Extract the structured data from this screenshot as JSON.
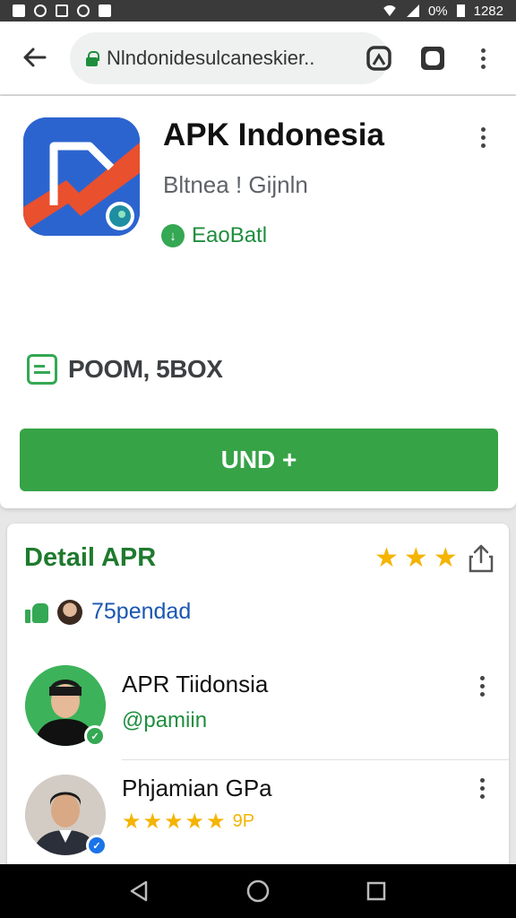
{
  "status_bar": {
    "time": "1282",
    "battery": "0%"
  },
  "browser": {
    "url": "Nlndonidesulcaneskier..",
    "icons": [
      "back-arrow-icon",
      "lock-icon",
      "tab-icon",
      "square-icon",
      "more-vert-icon"
    ]
  },
  "app": {
    "name": "APK Indonesia",
    "developer": "Bltnea ! Gijnln",
    "verified_label": "EaoBatl",
    "size_label": "POOM, 5BOX",
    "install_label": "UND +",
    "accent_color": "#36a347"
  },
  "detail": {
    "title": "Detail APR",
    "stars": [
      "★",
      "★",
      "★"
    ],
    "likes": "75pendad",
    "items": [
      {
        "name": "APR Tiidonsia",
        "sub": "@pamiin"
      },
      {
        "name": "Phjamian GPa",
        "stars": [
          "★",
          "★",
          "★",
          "★",
          "★"
        ],
        "rating": "9P"
      }
    ]
  }
}
